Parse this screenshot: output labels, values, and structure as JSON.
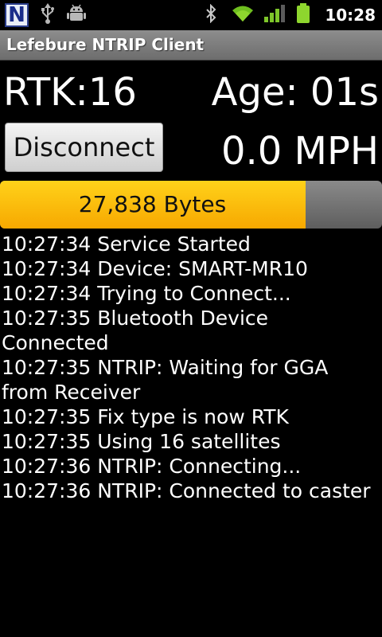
{
  "status_bar": {
    "icons_left": [
      "ntrip-app-icon",
      "usb-icon",
      "android-debug-icon"
    ],
    "app_icon_letter": "N",
    "icons_right": [
      "bluetooth-icon",
      "wifi-icon",
      "signal-icon",
      "battery-icon"
    ],
    "time": "10:28"
  },
  "title_bar": {
    "title": "Lefebure NTRIP Client"
  },
  "info": {
    "rtk": "RTK:16",
    "age": "Age: 01s",
    "speed": "0.0 MPH"
  },
  "controls": {
    "disconnect_label": "Disconnect"
  },
  "progress": {
    "label": "27,838 Bytes",
    "fill_fraction": 0.8,
    "fill_color": "#fbbd08",
    "track_color": "#6e6e6e"
  },
  "log": {
    "entries": [
      "10:27:34 Service Started",
      "10:27:34 Device: SMART-MR10",
      "10:27:34 Trying to Connect...",
      "10:27:35 Bluetooth Device Connected",
      "10:27:35 NTRIP: Waiting for GGA from Receiver",
      "10:27:35 Fix type is now RTK",
      "10:27:35 Using 16 satellites",
      "10:27:36 NTRIP: Connecting...",
      "10:27:36 NTRIP: Connected to caster"
    ]
  }
}
